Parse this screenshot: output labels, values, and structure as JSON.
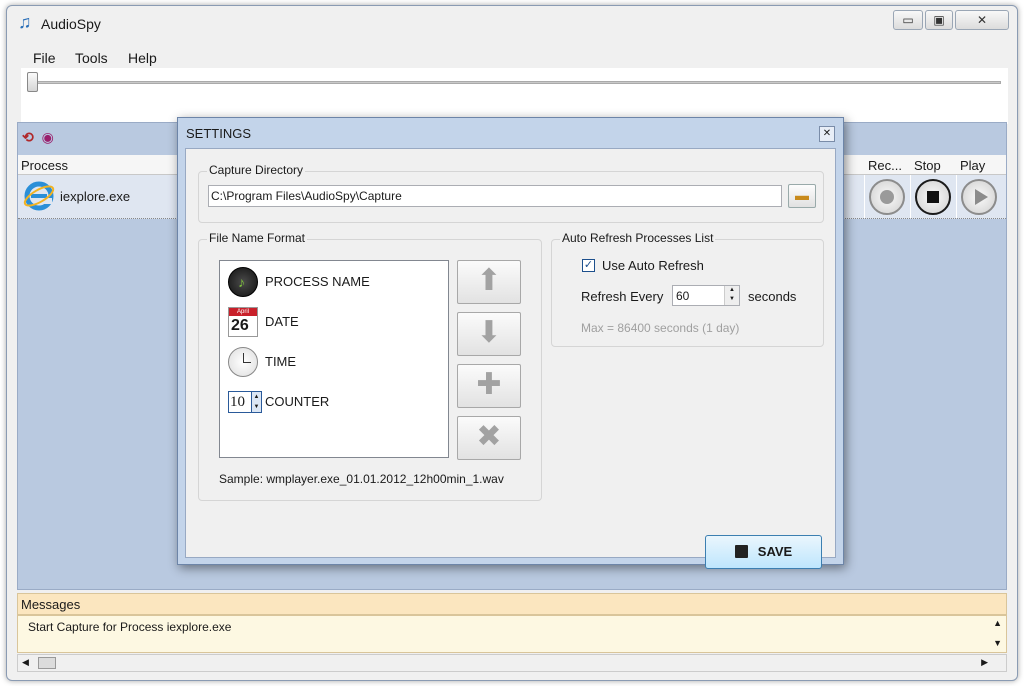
{
  "app": {
    "title": "AudioSpy",
    "icon": "music-note-icon"
  },
  "window_controls": {
    "minimize": "▭",
    "maximize": "▣",
    "close": "✕"
  },
  "menu": [
    "File",
    "Tools",
    "Help"
  ],
  "process_panel": {
    "columns": {
      "process": "Process",
      "record": "Rec...",
      "stop": "Stop",
      "play": "Play"
    },
    "rows": [
      {
        "name": "iexplore.exe",
        "icon": "internet-explorer-icon"
      }
    ]
  },
  "dialog": {
    "title": "SETTINGS",
    "close": "✕",
    "capture_directory": {
      "label": "Capture Directory",
      "value": "C:\\Program Files\\AudioSpy\\Capture",
      "browse_icon": "folder-icon"
    },
    "file_name_format": {
      "label": "File Name Format",
      "items": [
        {
          "label": "PROCESS NAME",
          "icon": "music-disc-icon"
        },
        {
          "label": "DATE",
          "icon": "calendar-icon",
          "day": "26",
          "month": "April"
        },
        {
          "label": "TIME",
          "icon": "clock-icon"
        },
        {
          "label": "COUNTER",
          "icon": "counter-icon",
          "value": "10"
        }
      ],
      "sample": "Sample: wmplayer.exe_01.01.2012_12h00min_1.wav"
    },
    "auto_refresh": {
      "label": "Auto Refresh Processes List",
      "use_label": "Use Auto Refresh",
      "use_checked": true,
      "refresh_label": "Refresh Every",
      "refresh_value": "60",
      "unit": "seconds",
      "hint": "Max = 86400 seconds (1 day)"
    },
    "save_label": "SAVE"
  },
  "messages": {
    "header": "Messages",
    "lines": [
      "Start Capture for Process iexplore.exe"
    ]
  }
}
